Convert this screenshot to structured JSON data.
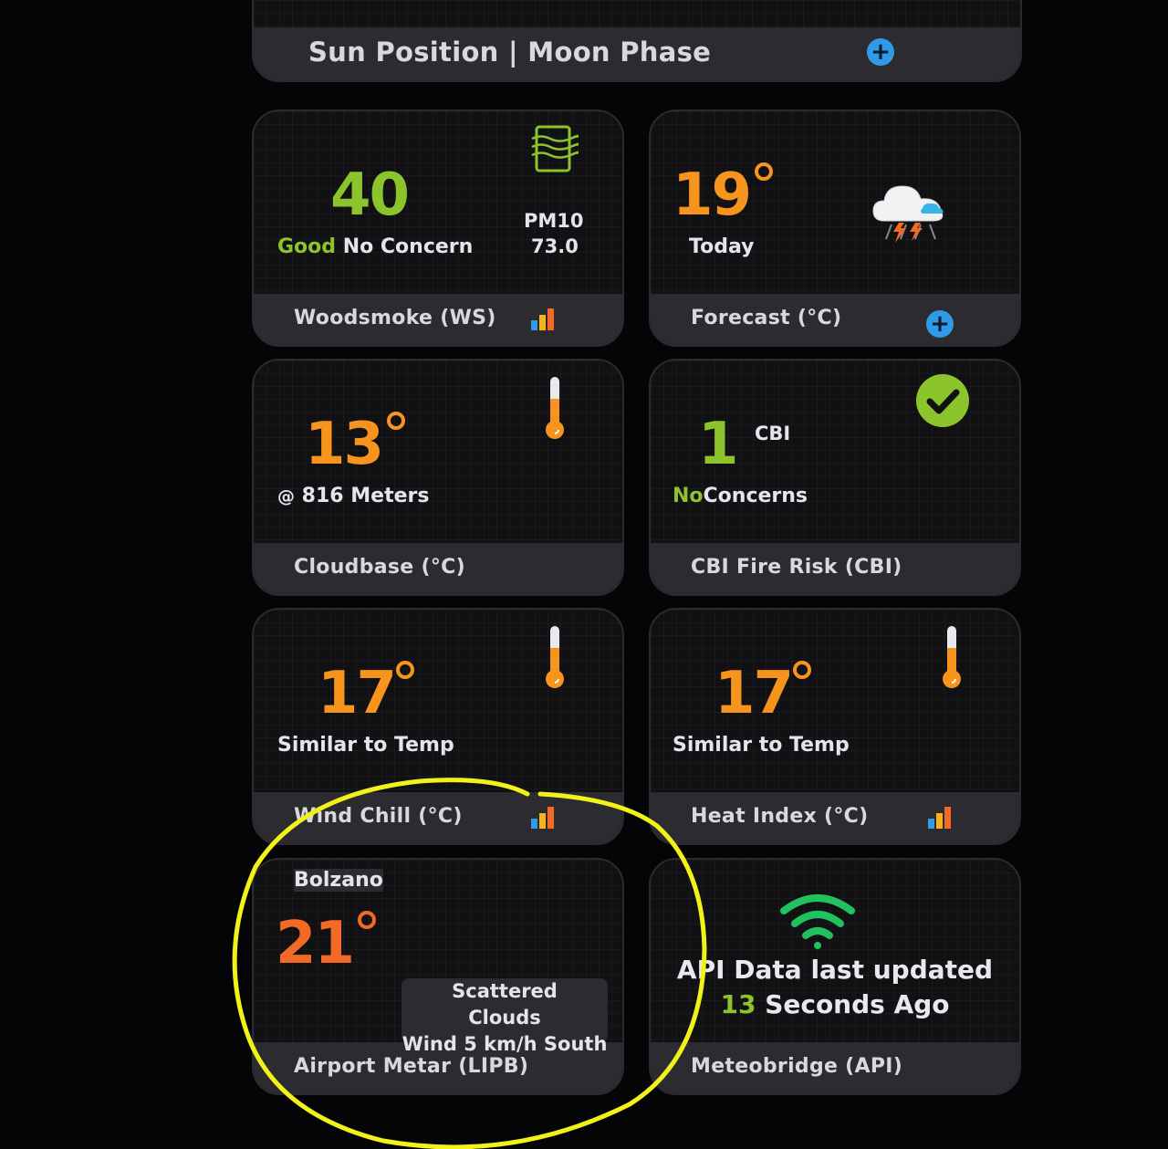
{
  "top_card": {
    "label": "Sun Position | Moon Phase"
  },
  "woodsmoke": {
    "value": "40",
    "status_word": "Good",
    "status_rest": "No Concern",
    "metric_name": "PM10",
    "metric_value": "73.0",
    "label": "Woodsmoke (WS)"
  },
  "forecast": {
    "value": "19",
    "sub": "Today",
    "label": "Forecast (°C)"
  },
  "cloudbase": {
    "value": "13",
    "at_symbol": "@",
    "sub": "816 Meters",
    "label": "Cloudbase (°C)"
  },
  "cbi": {
    "value": "1",
    "unit": "CBI",
    "status_word": "No",
    "status_rest": "Concerns",
    "label": "CBI Fire Risk (CBI)"
  },
  "wind_chill": {
    "value": "17",
    "sub": "Similar to Temp",
    "label": "Wind Chill (°C)"
  },
  "heat_index": {
    "value": "17",
    "sub": "Similar to Temp",
    "label": "Heat Index (°C)"
  },
  "metar": {
    "city": "Bolzano",
    "value": "21",
    "condition_line1": "Scattered",
    "condition_line2": "Clouds",
    "wind": "Wind 5 km/h South",
    "label": "Airport Metar (LIPB)"
  },
  "api": {
    "line1": "API Data last updated",
    "seconds": "13",
    "line2_rest": "Seconds Ago",
    "label": "Meteobridge (API)"
  },
  "colors": {
    "green": "#8cc42b",
    "orange": "#f7941d",
    "red_orange": "#f26a25",
    "blue": "#2f9ae8",
    "wifi_green": "#21c25e",
    "annotation_yellow": "#f2f21a"
  }
}
